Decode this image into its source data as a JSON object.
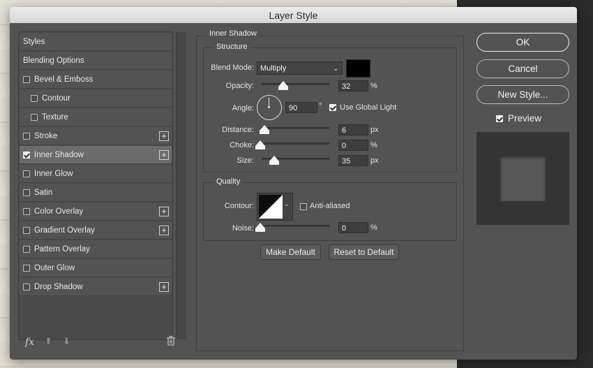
{
  "window": {
    "title": "Layer Style"
  },
  "sidebar": {
    "items": [
      {
        "label": "Styles",
        "checkbox": false,
        "checked": false,
        "plus": false,
        "indent": 0,
        "selected": false
      },
      {
        "label": "Blending Options",
        "checkbox": false,
        "checked": false,
        "plus": false,
        "indent": 0,
        "selected": false
      },
      {
        "label": "Bevel & Emboss",
        "checkbox": true,
        "checked": false,
        "plus": false,
        "indent": 0,
        "selected": false
      },
      {
        "label": "Contour",
        "checkbox": true,
        "checked": false,
        "plus": false,
        "indent": 1,
        "selected": false
      },
      {
        "label": "Texture",
        "checkbox": true,
        "checked": false,
        "plus": false,
        "indent": 1,
        "selected": false
      },
      {
        "label": "Stroke",
        "checkbox": true,
        "checked": false,
        "plus": true,
        "indent": 0,
        "selected": false
      },
      {
        "label": "Inner Shadow",
        "checkbox": true,
        "checked": true,
        "plus": true,
        "indent": 0,
        "selected": true
      },
      {
        "label": "Inner Glow",
        "checkbox": true,
        "checked": false,
        "plus": false,
        "indent": 0,
        "selected": false
      },
      {
        "label": "Satin",
        "checkbox": true,
        "checked": false,
        "plus": false,
        "indent": 0,
        "selected": false
      },
      {
        "label": "Color Overlay",
        "checkbox": true,
        "checked": false,
        "plus": true,
        "indent": 0,
        "selected": false
      },
      {
        "label": "Gradient Overlay",
        "checkbox": true,
        "checked": false,
        "plus": true,
        "indent": 0,
        "selected": false
      },
      {
        "label": "Pattern Overlay",
        "checkbox": true,
        "checked": false,
        "plus": false,
        "indent": 0,
        "selected": false
      },
      {
        "label": "Outer Glow",
        "checkbox": true,
        "checked": false,
        "plus": false,
        "indent": 0,
        "selected": false
      },
      {
        "label": "Drop Shadow",
        "checkbox": true,
        "checked": false,
        "plus": true,
        "indent": 0,
        "selected": false
      }
    ],
    "bottom": {
      "fx": "fx",
      "fx_icon": "fx-icon",
      "up_icon": "arrow-up-icon",
      "down_icon": "arrow-down-icon",
      "trash_icon": "trash-icon"
    }
  },
  "panel": {
    "title": "Inner Shadow",
    "structure": {
      "title": "Structure",
      "blend_mode_label": "Blend Mode:",
      "blend_mode_value": "Multiply",
      "color_swatch": "#000000",
      "opacity_label": "Opacity:",
      "opacity_value": "32",
      "opacity_unit": "%",
      "angle_label": "Angle:",
      "angle_value": "90",
      "angle_unit": "°",
      "global_light_label": "Use Global Light",
      "global_light_checked": true,
      "distance_label": "Distance:",
      "distance_value": "6",
      "distance_unit": "px",
      "choke_label": "Choke:",
      "choke_value": "0",
      "choke_unit": "%",
      "size_label": "Size:",
      "size_value": "35",
      "size_unit": "px"
    },
    "quality": {
      "title": "Quality",
      "contour_label": "Contour:",
      "antialiased_label": "Anti-aliased",
      "antialiased_checked": false,
      "noise_label": "Noise:",
      "noise_value": "0",
      "noise_unit": "%"
    },
    "make_default": "Make Default",
    "reset_default": "Reset to Default"
  },
  "actions": {
    "ok": "OK",
    "cancel": "Cancel",
    "new_style": "New Style...",
    "preview_label": "Preview",
    "preview_checked": true
  },
  "colors": {
    "dialog_bg": "#535353",
    "list_selected": "#6b6b6b",
    "preview_outer": "#333333",
    "preview_inner": "#555555"
  }
}
